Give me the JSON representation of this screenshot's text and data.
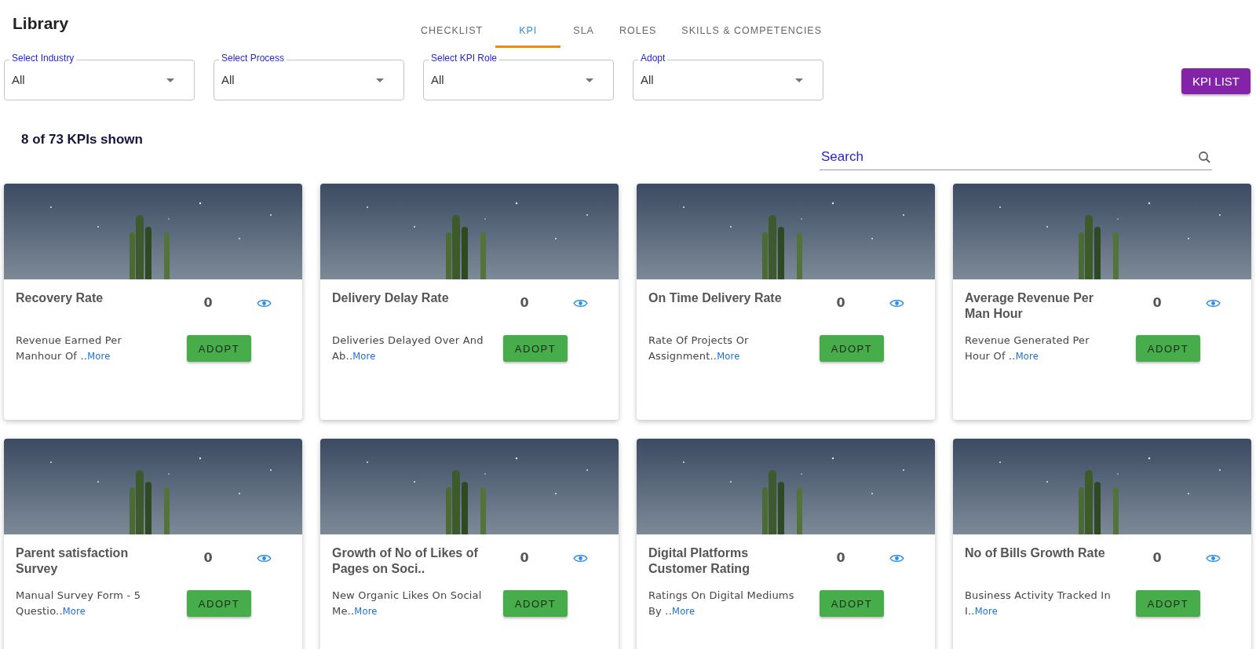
{
  "header": {
    "title": "Library"
  },
  "tabs": [
    {
      "label": "CHECKLIST",
      "selected": false
    },
    {
      "label": "KPI",
      "selected": true
    },
    {
      "label": "SLA",
      "selected": false
    },
    {
      "label": "ROLES",
      "selected": false
    },
    {
      "label": "SKILLS & COMPETENCIES",
      "selected": false
    }
  ],
  "filters": [
    {
      "label": "Select Industry",
      "value": "All"
    },
    {
      "label": "Select Process",
      "value": "All"
    },
    {
      "label": "Select KPI Role",
      "value": "All"
    },
    {
      "label": "Adopt",
      "value": "All"
    }
  ],
  "kpi_list_button": "KPI LIST",
  "count_text": "8 of 73 KPIs shown",
  "search": {
    "placeholder": "Search"
  },
  "cards": [
    {
      "title": "Recovery Rate",
      "count": "0",
      "description": "Revenue Earned Per Manhour Of ..",
      "more": "More",
      "button": "ADOPT"
    },
    {
      "title": "Delivery Delay Rate",
      "count": "0",
      "description": "Deliveries Delayed Over And Ab..",
      "more": "More",
      "button": "ADOPT"
    },
    {
      "title": "On Time Delivery Rate",
      "count": "0",
      "description": "Rate Of Projects Or Assignment..",
      "more": "More",
      "button": "ADOPT"
    },
    {
      "title": "Average Revenue Per Man Hour",
      "count": "0",
      "description": "Revenue Generated Per Hour Of ..",
      "more": "More",
      "button": "ADOPT"
    },
    {
      "title": "Parent satisfaction Survey",
      "count": "0",
      "description": "Manual Survey Form - 5 Questio..",
      "more": "More",
      "button": "ADOPT"
    },
    {
      "title": "Growth of No of Likes of Pages on Soci..",
      "count": "0",
      "description": "New Organic Likes On Social Me..",
      "more": "More",
      "button": "ADOPT"
    },
    {
      "title": "Digital Platforms Customer Rating",
      "count": "0",
      "description": "Ratings On Digital Mediums By ..",
      "more": "More",
      "button": "ADOPT"
    },
    {
      "title": "No of Bills Growth Rate",
      "count": "0",
      "description": "Business Activity Tracked In I..",
      "more": "More",
      "button": "ADOPT"
    }
  ]
}
